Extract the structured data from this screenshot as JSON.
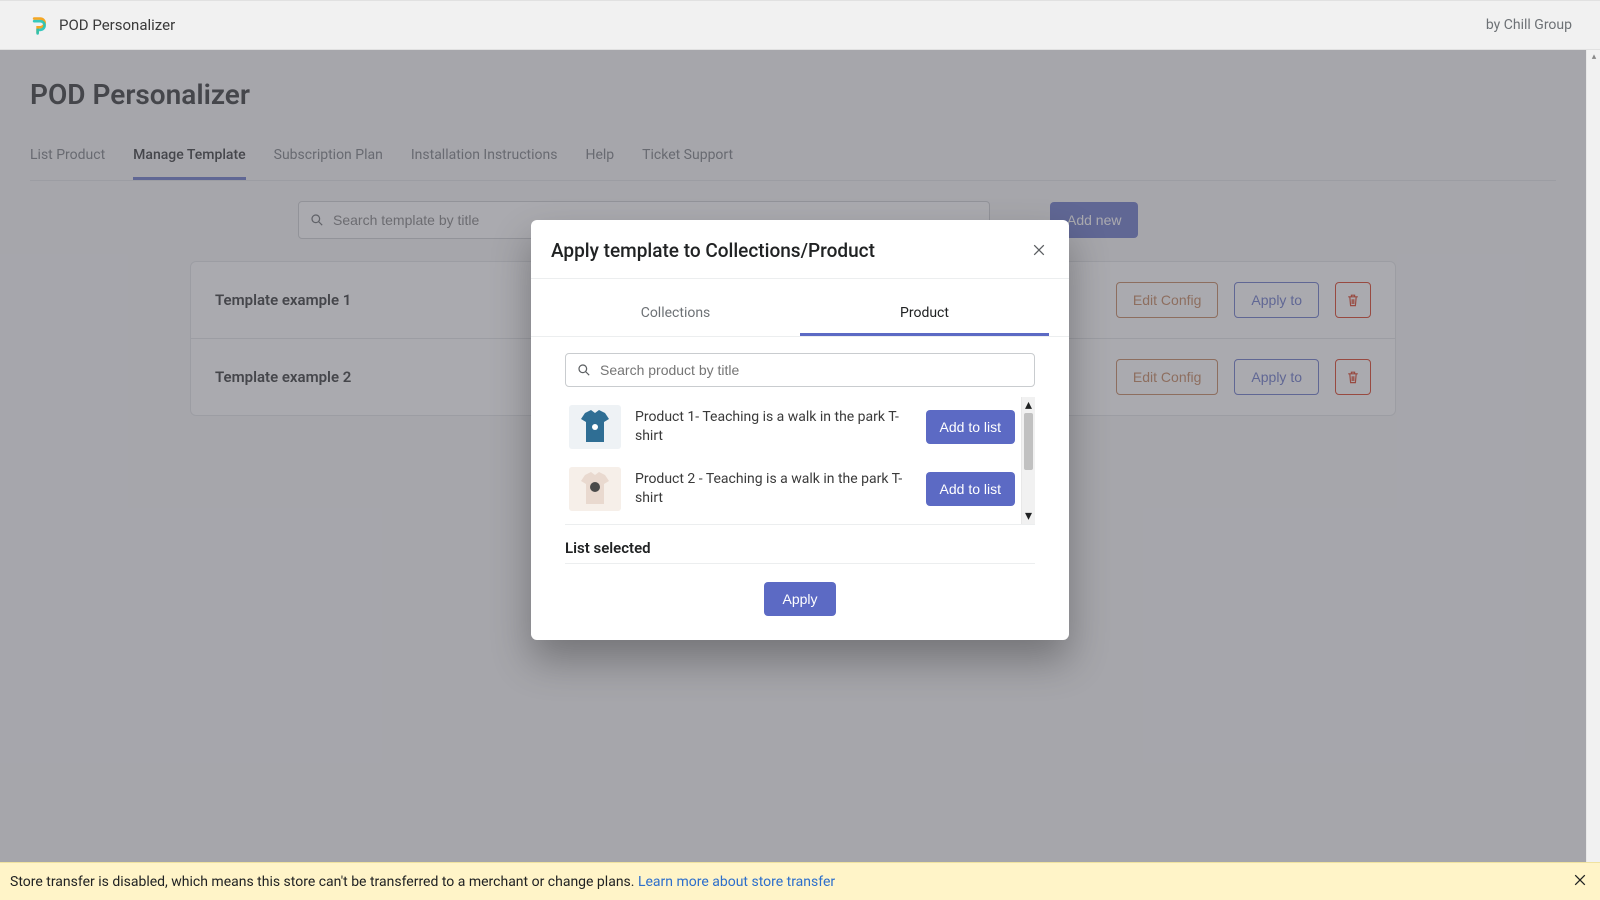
{
  "topbar": {
    "app_name": "POD Personalizer",
    "by_text": "by Chill Group"
  },
  "page": {
    "title": "POD Personalizer",
    "tabs": [
      "List Product",
      "Manage Template",
      "Subscription Plan",
      "Installation Instructions",
      "Help",
      "Ticket Support"
    ],
    "active_tab": 1,
    "search_placeholder": "Search template by title",
    "add_new_label": "Add new",
    "templates": [
      {
        "name": "Template example 1",
        "edit": "Edit Config",
        "apply": "Apply to"
      },
      {
        "name": "Template example 2",
        "edit": "Edit Config",
        "apply": "Apply to"
      }
    ]
  },
  "modal": {
    "title": "Apply template to Collections/Product",
    "tabs": [
      "Collections",
      "Product"
    ],
    "active_tab": 1,
    "search_placeholder": "Search product by title",
    "products": [
      {
        "title": "Product 1- Teaching is a walk in the park T-shirt",
        "add": "Add to list",
        "color": "#2f6e94"
      },
      {
        "title": "Product 2 - Teaching is a walk in the park T-shirt",
        "add": "Add to list",
        "color": "#e9d9cf"
      }
    ],
    "list_selected": "List selected",
    "apply_label": "Apply"
  },
  "banner": {
    "text": "Store transfer is disabled, which means this store can't be transferred to a merchant or change plans. ",
    "link": "Learn more about store transfer"
  }
}
